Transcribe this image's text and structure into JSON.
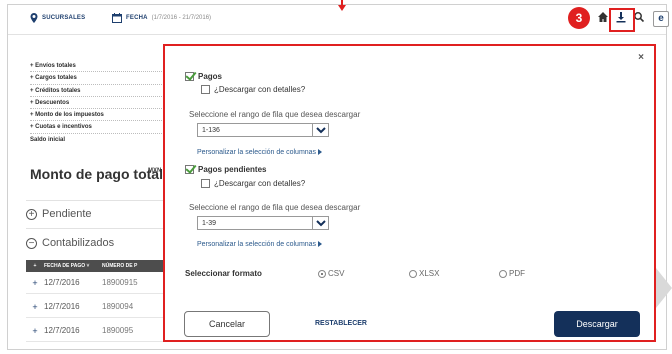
{
  "header": {
    "sucursales_label": "SUCURSALES",
    "fecha_label": "FECHA",
    "fecha_range": "(1/7/2016 - 21/7/2016)",
    "step_number": "3",
    "e_button": "e",
    "icons": [
      "home-icon",
      "download-icon",
      "search-icon"
    ]
  },
  "summary": {
    "rows": [
      "+ Envíos totales",
      "+ Cargos totales",
      "+ Créditos totales",
      "+ Descuentos",
      "+ Monto de los impuestos",
      "+ Cuotas e incentivos",
      "Saldo inicial"
    ]
  },
  "monto": {
    "title": "Monto de pago total",
    "currency": "MXN"
  },
  "sections": {
    "pendiente": "Pendiente",
    "contabilizados": "Contabilizados"
  },
  "table": {
    "headers": [
      "FECHA DE PAGO ˅",
      "NÚMERO DE P"
    ],
    "rows": [
      {
        "date": "12/7/2016",
        "num": "18900915​"
      },
      {
        "date": "12/7/2016",
        "num": "1890094​"
      },
      {
        "date": "12/7/2016",
        "num": "1890095​"
      }
    ]
  },
  "modal": {
    "close": "×",
    "pagos": {
      "label": "Pagos",
      "detail_label": "¿Descargar con detalles?",
      "range_label": "Seleccione el rango de fila que desea descargar",
      "range_value": "1-136",
      "customize": "Personalizar la selección de columnas"
    },
    "pendientes": {
      "label": "Pagos pendientes",
      "detail_label": "¿Descargar con detalles?",
      "range_label": "Seleccione el rango de fila que desea descargar",
      "range_value": "1-39",
      "customize": "Personalizar la selección de columnas"
    },
    "format": {
      "label": "Seleccionar formato",
      "options": [
        "CSV",
        "XLSX",
        "PDF"
      ],
      "selected": "CSV"
    },
    "buttons": {
      "cancel": "Cancelar",
      "reset": "RESTABLECER",
      "download": "Descargar"
    }
  }
}
